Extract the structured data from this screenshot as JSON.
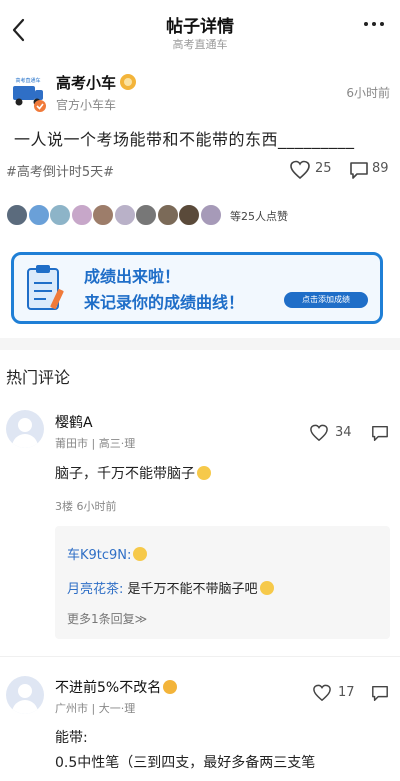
{
  "header": {
    "title": "帖子详情",
    "subtitle": "高考直通车"
  },
  "post": {
    "author": "高考小车",
    "role": "官方小车车",
    "time": "6小时前",
    "text": "一人说一个考场能带和不能带的东西_________",
    "tag": "#高考倒计时5天#",
    "like_count": "25",
    "comment_count": "89",
    "likers_text": "等25人点赞",
    "liker_colors": [
      "#5b6b7d",
      "#6aa0d8",
      "#8db4c8",
      "#c7a7c9",
      "#9d7d6a",
      "#b9b1c8",
      "#777777",
      "#7b6a58",
      "#5a4a3a",
      "#a69ab8"
    ]
  },
  "banner": {
    "line1": "成绩出来啦！",
    "line2": "来记录你的成绩曲线！",
    "button": "点击添加成绩",
    "accent": "#1f7fd6"
  },
  "section_title": "热门评论",
  "comments": [
    {
      "name": "樱鹤A",
      "meta": "莆田市 | 高三·理",
      "like_count": "34",
      "text": "脑子，千万不能带脑子",
      "sub": "3楼  6小时前",
      "replies": [
        {
          "user": "车K9tc9N:",
          "text": ""
        },
        {
          "user": "月亮花茶:",
          "text": " 是千万不能不带脑子吧"
        }
      ],
      "more_replies": "更多1条回复≫"
    },
    {
      "name": "不进前5%不改名",
      "meta": "广州市 | 大一·理",
      "like_count": "17",
      "text_line1": "能带:",
      "text_line2": "0.5中性笔（三到四支，最好多备两三支笔"
    }
  ]
}
